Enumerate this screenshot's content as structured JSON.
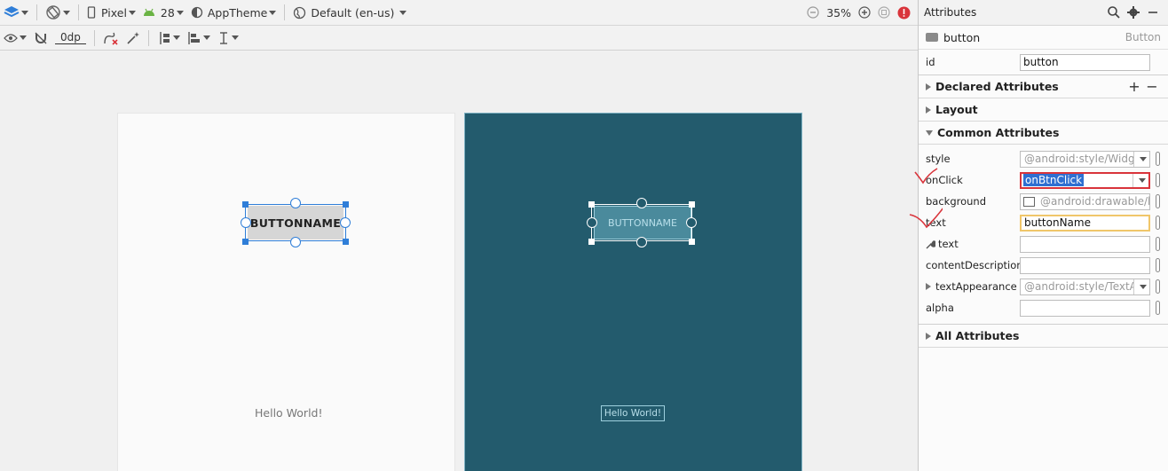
{
  "toolbar1": {
    "device": "Pixel",
    "api": "28",
    "theme": "AppTheme",
    "locale": "Default (en-us)",
    "zoom": "35%"
  },
  "toolbar2": {
    "margin": "0dp"
  },
  "canvas": {
    "design_button": "BUTTONNAME",
    "design_hello": "Hello World!",
    "blueprint_button": "BUTTONNAME",
    "blueprint_hello": "Hello World!"
  },
  "panel": {
    "title": "Attributes",
    "component_name": "button",
    "component_type": "Button",
    "id_label": "id",
    "id_value": "button",
    "sections": {
      "declared": "Declared Attributes",
      "layout": "Layout",
      "common": "Common Attributes",
      "all": "All Attributes"
    },
    "attributes": [
      {
        "label": "style",
        "value": "@android:style/Widg",
        "kind": "dropdown"
      },
      {
        "label": "onClick",
        "value": "onBtnClick",
        "kind": "dropdown-selected"
      },
      {
        "label": "background",
        "value": "@android:drawable/btn",
        "kind": "image"
      },
      {
        "label": "text",
        "value": "buttonName",
        "kind": "text-focused"
      },
      {
        "label": "text",
        "value": "",
        "kind": "tool-text"
      },
      {
        "label": "contentDescription",
        "value": "",
        "kind": "text"
      },
      {
        "label": "textAppearance",
        "value": "@android:style/TextA",
        "kind": "dropdown"
      },
      {
        "label": "alpha",
        "value": "",
        "kind": "text"
      }
    ]
  },
  "colors": {
    "blueprint_bg": "#235b6d",
    "selection_blue": "#2f7ed8",
    "annotation_red": "#d9343b",
    "focus_yellow": "#f0c66a"
  }
}
